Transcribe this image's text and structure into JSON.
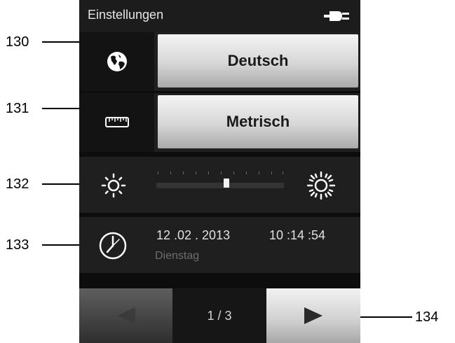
{
  "callouts": {
    "language": "130",
    "units": "131",
    "brightness": "132",
    "datetime": "133",
    "navigation": "134"
  },
  "titlebar": {
    "title": "Einstellungen",
    "power_icon": "plug-icon"
  },
  "language": {
    "icon": "globe-icon",
    "value": "Deutsch"
  },
  "units": {
    "icon": "ruler-icon",
    "value": "Metrisch"
  },
  "brightness": {
    "icon_low": "sun-low-icon",
    "icon_high": "sun-high-icon",
    "level_fraction": 0.55
  },
  "datetime": {
    "icon": "clock-icon",
    "date": "12 .02 . 2013",
    "time": "10 :14 :54",
    "weekday": "Dienstag"
  },
  "pager": {
    "prev_icon": "triangle-left-icon",
    "next_icon": "triangle-right-icon",
    "page": "1 / 3"
  },
  "colors": {
    "screen_bg": "#0d0d0d",
    "row_bg": "#1f1f1f",
    "button_light": "#e0e0e0",
    "text_light": "#e0e0e0",
    "text_dim": "#6d6d6d"
  }
}
